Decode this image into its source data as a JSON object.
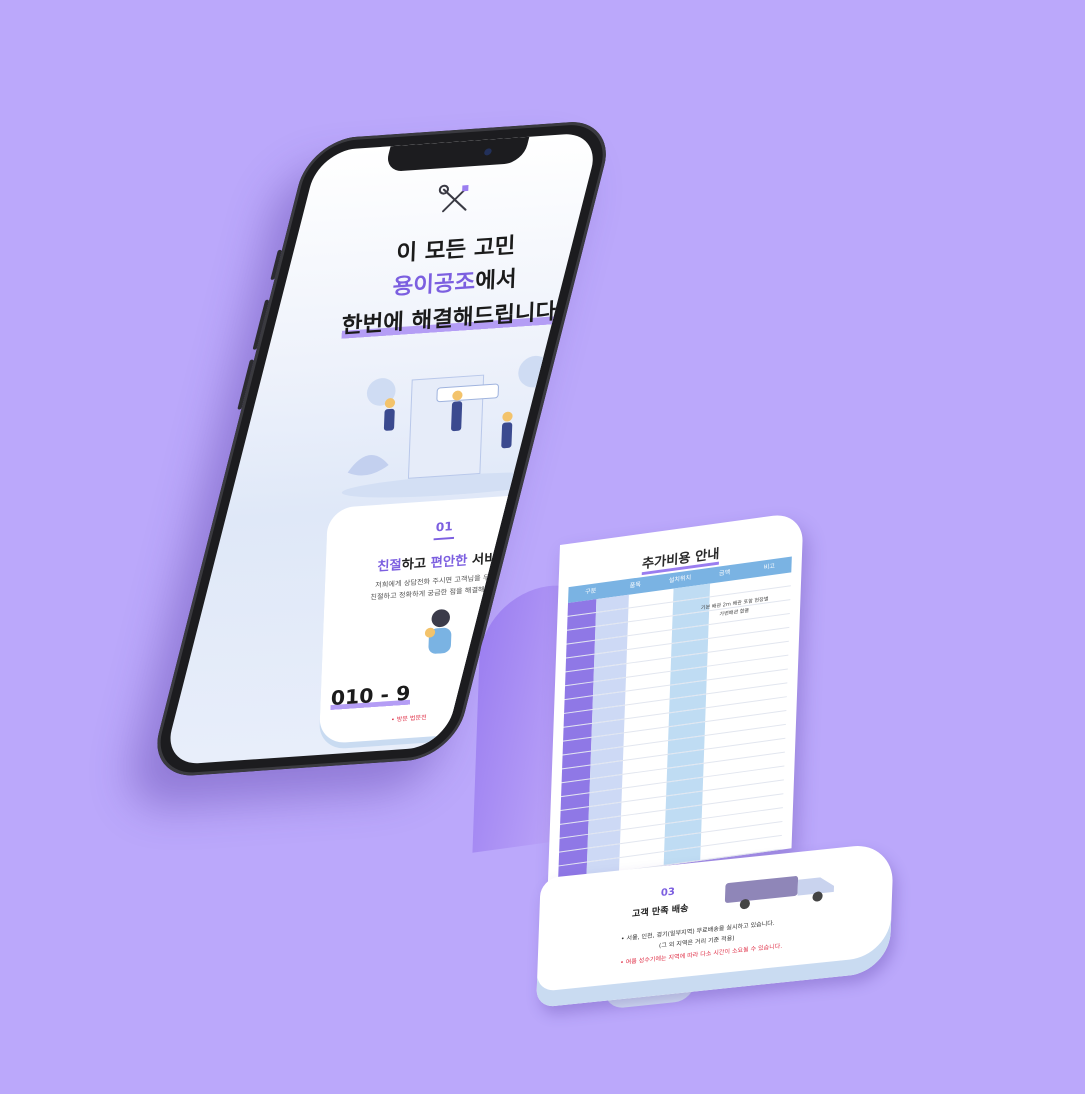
{
  "screen": {
    "title_line1": "이 모든 고민",
    "brand": "용이공조",
    "title_line2_suffix": "에서",
    "title_line3": "한번에 해결해드립니다.",
    "icon": "wrench-screwdriver-icon"
  },
  "service_card": {
    "number": "01",
    "title_accent1": "친절",
    "title_mid": "하고 ",
    "title_accent2": "편안한",
    "title_end": " 서비스",
    "desc_line1": "저희에게 상담전화 주시면 고객님을 우선으로",
    "desc_line2": "친절하고 정확하게 궁금한 점을 해결해드립니다.",
    "phone": "010 - 9",
    "note": "• 방문 법문전"
  },
  "sheet": {
    "title": "추가비용 안내",
    "headers": [
      "구분",
      "품목",
      "설치위치",
      "금액",
      "비고"
    ],
    "note": "기본 배관 2m 배관 포함 현장별 가변배관 합을"
  },
  "curl": {
    "number": "03",
    "title": "고객 만족 배송",
    "line1": "• 서울, 인천, 경기(일부지역) 무료배송을 실시하고 있습니다.",
    "line2": "(그 외 지역은 거리 기준 적용)",
    "line3": "• 여름 성수기에는 지역에 따라 다소 시간이 소요될 수 있습니다."
  },
  "colors": {
    "background": "#bba8fb",
    "accent": "#7c5fe0",
    "table_header": "#7ab3e3"
  }
}
